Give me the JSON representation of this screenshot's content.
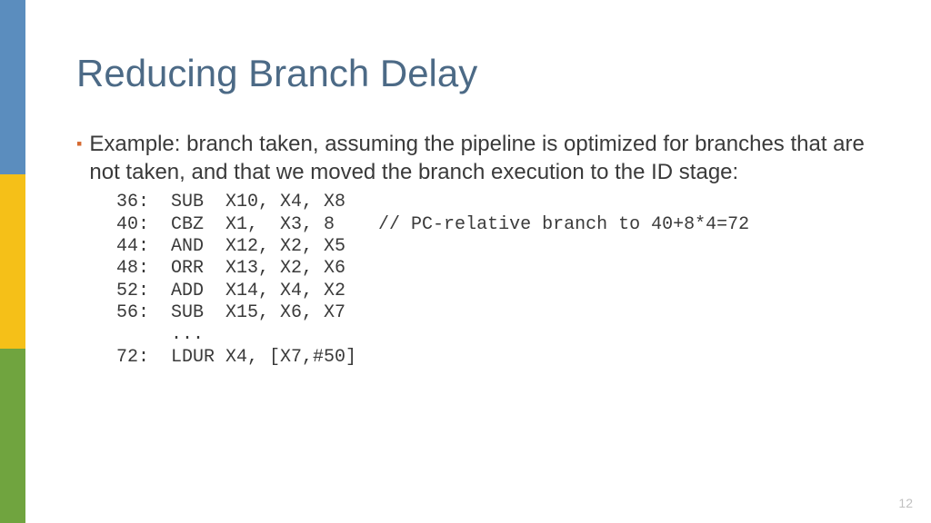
{
  "title": "Reducing Branch Delay",
  "bullet": "Example: branch taken, assuming the pipeline is optimized for branches that are not taken, and that we moved the branch execution to the ID stage:",
  "code_lines": {
    "l0": "36:  SUB  X10, X4, X8",
    "l1": "40:  CBZ  X1,  X3, 8    // PC-relative branch to 40+8*4=72",
    "l2": "44:  AND  X12, X2, X5",
    "l3": "48:  ORR  X13, X2, X6",
    "l4": "52:  ADD  X14, X4, X2",
    "l5": "56:  SUB  X15, X6, X7",
    "l6": "     ...",
    "l7": "72:  LDUR X4, [X7,#50]"
  },
  "page_number": "12",
  "colors": {
    "blue": "#5B8DBE",
    "yellow": "#F5C018",
    "green": "#70A43F",
    "title": "#4C6A86",
    "bullet_mark": "#D56A31"
  }
}
